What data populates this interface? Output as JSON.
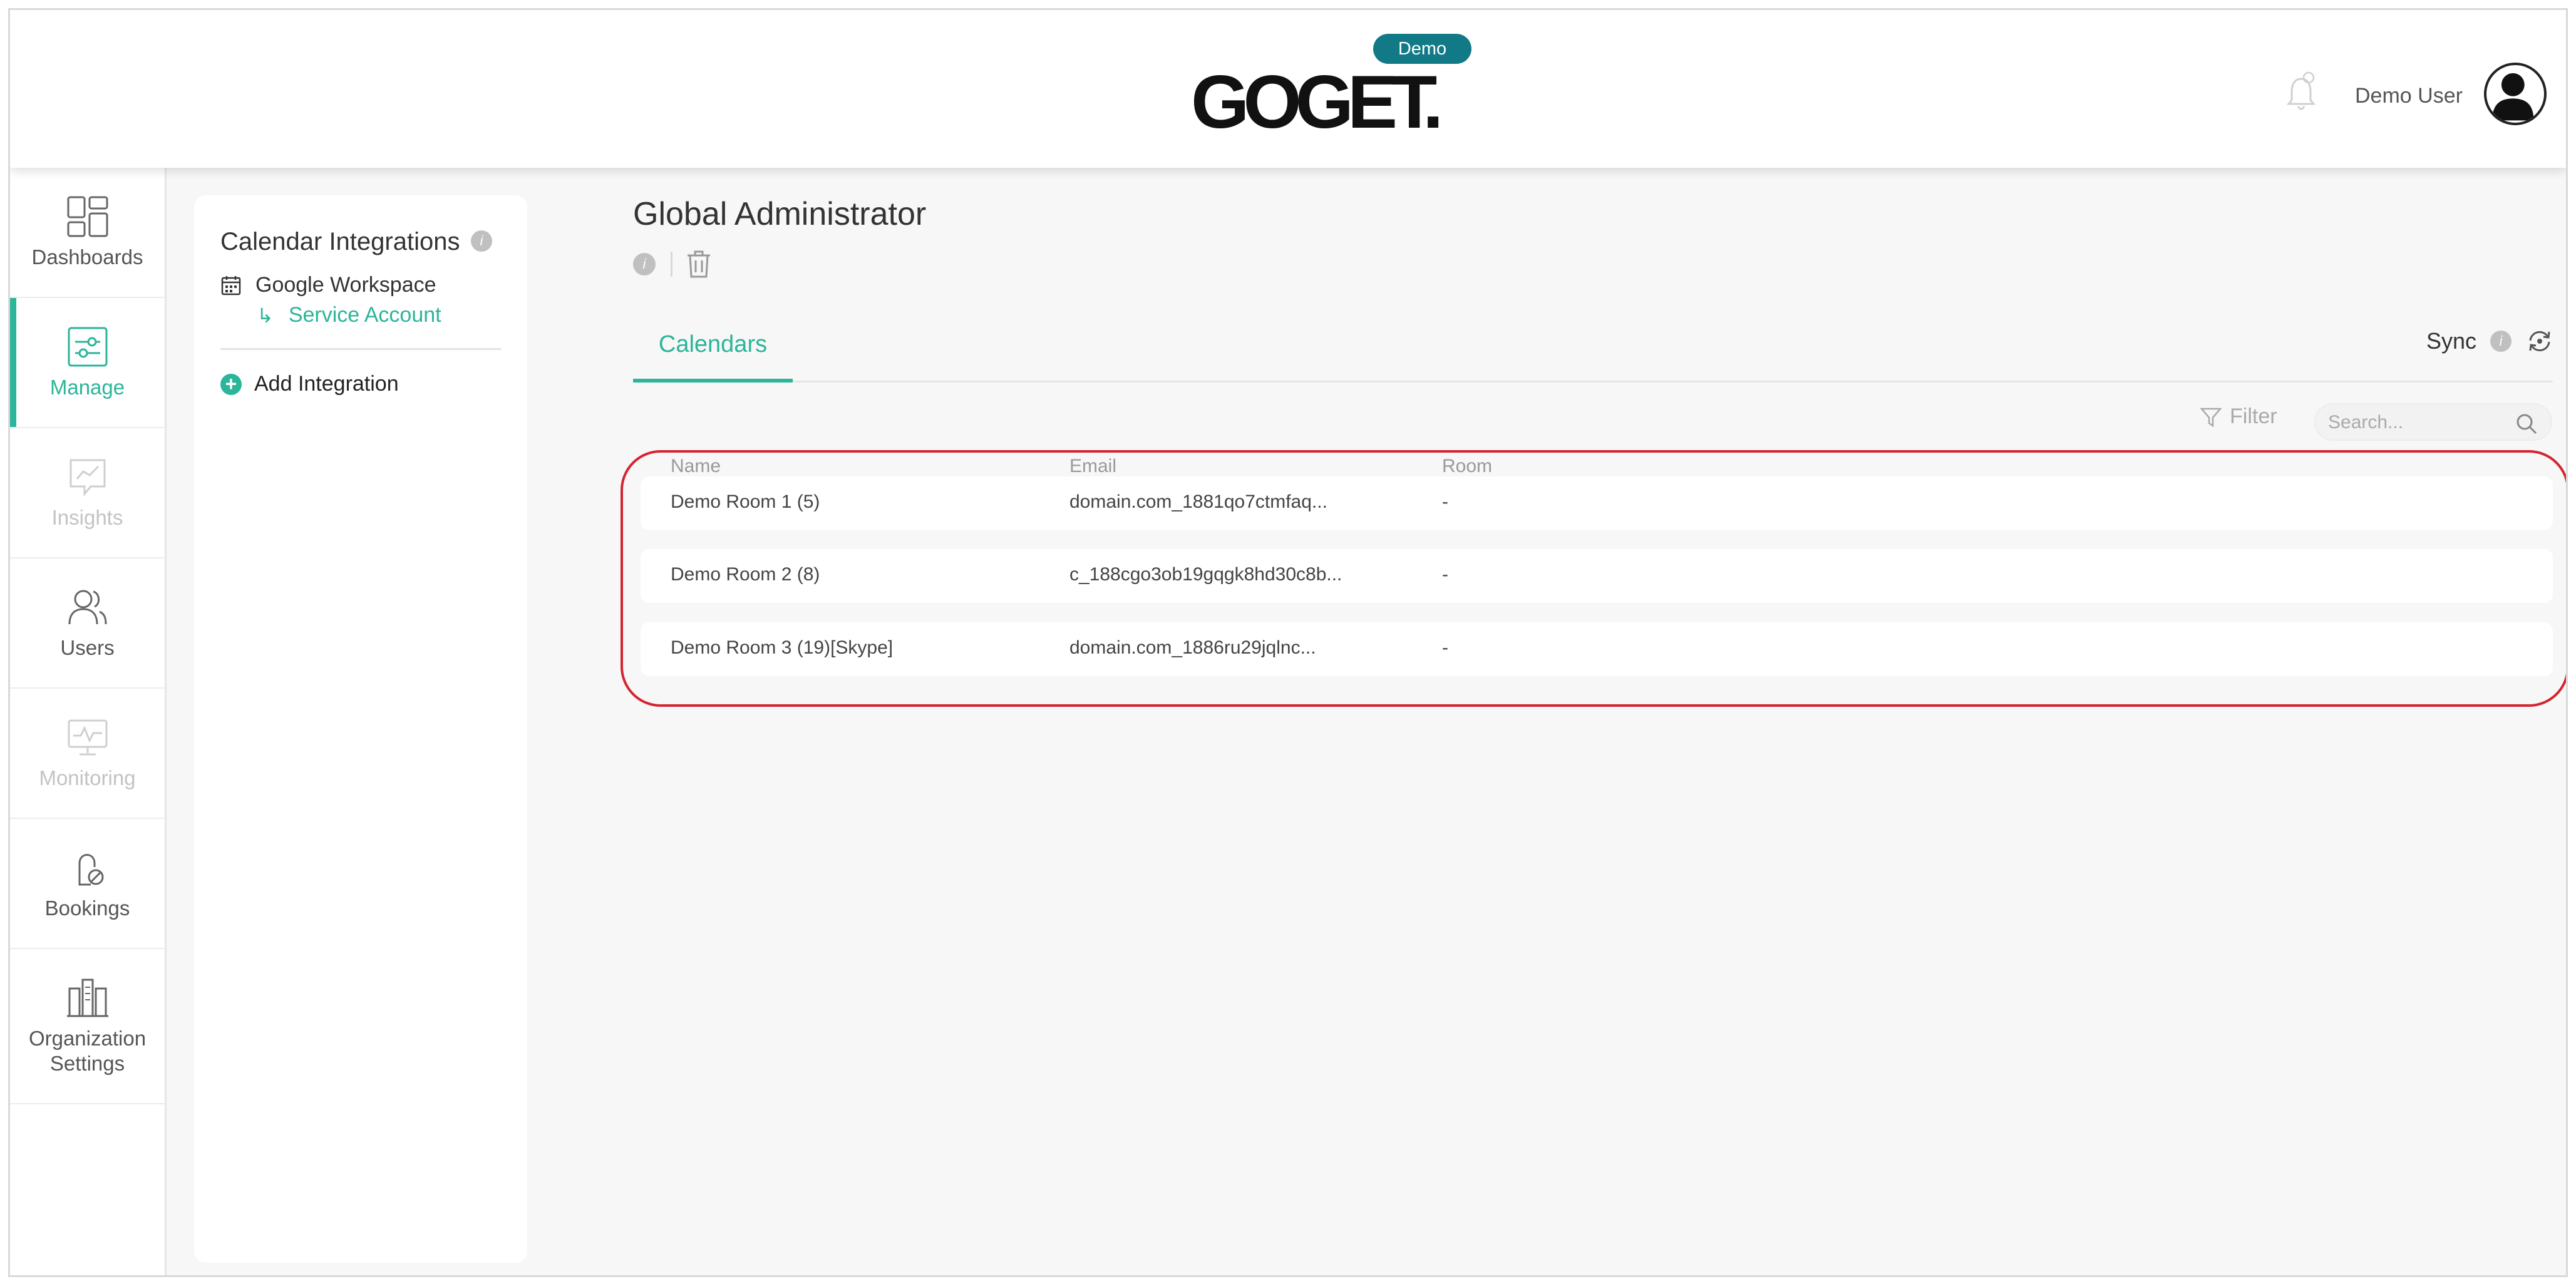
{
  "header": {
    "logo_text": "GOGET.",
    "badge": "Demo",
    "user_name": "Demo User"
  },
  "nav": {
    "items": [
      {
        "label": "Dashboards",
        "icon": "dashboards-icon",
        "state": "normal"
      },
      {
        "label": "Manage",
        "icon": "manage-icon",
        "state": "active"
      },
      {
        "label": "Insights",
        "icon": "insights-icon",
        "state": "disabled"
      },
      {
        "label": "Users",
        "icon": "users-icon",
        "state": "normal"
      },
      {
        "label": "Monitoring",
        "icon": "monitoring-icon",
        "state": "disabled"
      },
      {
        "label": "Bookings",
        "icon": "bookings-icon",
        "state": "normal"
      },
      {
        "label": "Organization Settings",
        "icon": "organization-settings-icon",
        "state": "normal"
      }
    ]
  },
  "integrations": {
    "title": "Calendar Integrations",
    "info": "i",
    "google_workspace": "Google Workspace",
    "service_account": "Service Account",
    "add_integration": "Add Integration"
  },
  "main": {
    "title": "Global Administrator",
    "info": "i",
    "tab_calendars": "Calendars",
    "sync_label": "Sync",
    "sync_info": "i",
    "filter_label": "Filter",
    "search_placeholder": "Search..."
  },
  "table": {
    "columns": [
      "Name",
      "Email",
      "Room"
    ],
    "rows": [
      {
        "name": "Demo Room 1 (5)",
        "email": "domain.com_1881qo7ctmfaq...",
        "room": "-"
      },
      {
        "name": "Demo Room 2 (8)",
        "email": "c_188cgo3ob19gqgk8hd30c8b...",
        "room": "-"
      },
      {
        "name": "Demo Room 3 (19)[Skype]",
        "email": "domain.com_1886ru29jqlnc...",
        "room": "-"
      }
    ]
  },
  "colors": {
    "accent": "#2bb59a",
    "badge": "#127a86",
    "highlight": "#d42430"
  }
}
